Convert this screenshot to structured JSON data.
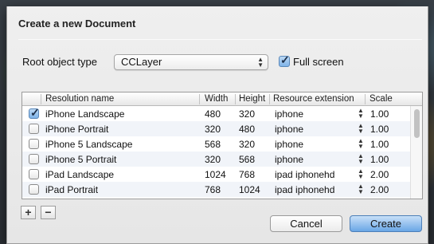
{
  "dialog": {
    "title": "Create a new Document",
    "root_label": "Root object type",
    "root_value": "CCLayer",
    "fullscreen_label": "Full screen",
    "fullscreen_checked": true
  },
  "table": {
    "columns": [
      "Resolution name",
      "Width",
      "Height",
      "Resource extension",
      "Scale"
    ],
    "rows": [
      {
        "checked": true,
        "name": "iPhone Landscape",
        "width": "480",
        "height": "320",
        "ext": "iphone",
        "scale": "1.00"
      },
      {
        "checked": false,
        "name": "iPhone Portrait",
        "width": "320",
        "height": "480",
        "ext": "iphone",
        "scale": "1.00"
      },
      {
        "checked": false,
        "name": "iPhone 5 Landscape",
        "width": "568",
        "height": "320",
        "ext": "iphone",
        "scale": "1.00"
      },
      {
        "checked": false,
        "name": "iPhone 5 Portrait",
        "width": "320",
        "height": "568",
        "ext": "iphone",
        "scale": "1.00"
      },
      {
        "checked": false,
        "name": "iPad Landscape",
        "width": "1024",
        "height": "768",
        "ext": "ipad iphonehd",
        "scale": "2.00"
      },
      {
        "checked": false,
        "name": "iPad Portrait",
        "width": "768",
        "height": "1024",
        "ext": "ipad iphonehd",
        "scale": "2.00"
      }
    ]
  },
  "buttons": {
    "add": "+",
    "remove": "−",
    "cancel": "Cancel",
    "create": "Create"
  },
  "colors": {
    "accent": "#6aa6e6"
  }
}
